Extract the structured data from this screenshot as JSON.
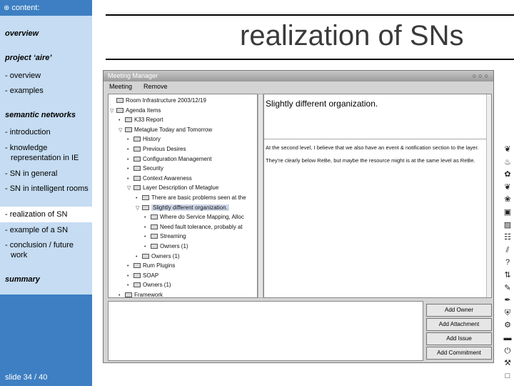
{
  "nav": {
    "header_icon": "circle-plus-icon",
    "header": "content:",
    "items": [
      {
        "label": "overview",
        "kind": "section"
      },
      {
        "label": "project ‘aire’",
        "kind": "section"
      },
      {
        "label": "- overview",
        "kind": "sub"
      },
      {
        "label": "- examples",
        "kind": "sub"
      },
      {
        "label": "semantic networks",
        "kind": "section"
      },
      {
        "label": "- introduction",
        "kind": "sub"
      },
      {
        "label": "- knowledge representation in IE",
        "kind": "sub"
      },
      {
        "label": "- SN in general",
        "kind": "sub"
      },
      {
        "label": "- SN in intelligent rooms",
        "kind": "sub"
      },
      {
        "label": "- realization of SN",
        "kind": "active"
      },
      {
        "label": "- example of a SN",
        "kind": "sub"
      },
      {
        "label": "- conclusion / future work",
        "kind": "sub"
      },
      {
        "label": "summary",
        "kind": "section"
      }
    ],
    "slide_counter": "slide 34 / 40"
  },
  "title": "realization of SNs",
  "app": {
    "window_title": "Meeting Manager",
    "menu": [
      "Meeting",
      "Remove"
    ],
    "tree": [
      {
        "label": "Room Infrastructure 2003/12/19",
        "toggle": "",
        "depth": 0
      },
      {
        "label": "Agenda Items",
        "toggle": "▽",
        "depth": 0
      },
      {
        "label": "K33 Report",
        "toggle": "•",
        "depth": 1
      },
      {
        "label": "Metaglue Today and Tomorrow",
        "toggle": "▽",
        "depth": 1
      },
      {
        "label": "History",
        "toggle": "•",
        "depth": 2
      },
      {
        "label": "Previous Desires",
        "toggle": "•",
        "depth": 2
      },
      {
        "label": "Configuration Management",
        "toggle": "•",
        "depth": 2
      },
      {
        "label": "Security",
        "toggle": "•",
        "depth": 2
      },
      {
        "label": "Context Awareness",
        "toggle": "•",
        "depth": 2
      },
      {
        "label": "Layer Description of Metaglue",
        "toggle": "▽",
        "depth": 2
      },
      {
        "label": "There are basic problems seen at the",
        "toggle": "•",
        "depth": 3
      },
      {
        "label": "Slightly different organization.",
        "toggle": "▽",
        "depth": 3,
        "selected": true
      },
      {
        "label": "Where do Service Mapping, Alloc",
        "toggle": "•",
        "depth": 4
      },
      {
        "label": "Need fault tolerance, probably at",
        "toggle": "•",
        "depth": 4
      },
      {
        "label": "Streaming",
        "toggle": "•",
        "depth": 4
      },
      {
        "label": "Owners (1)",
        "toggle": "•",
        "depth": 4
      },
      {
        "label": "Owners (1)",
        "toggle": "•",
        "depth": 3
      },
      {
        "label": "Rum Plugins",
        "toggle": "•",
        "depth": 2
      },
      {
        "label": "SOAP",
        "toggle": "•",
        "depth": 2
      },
      {
        "label": "Owners (1)",
        "toggle": "•",
        "depth": 2
      },
      {
        "label": "Framework",
        "toggle": "•",
        "depth": 1
      }
    ],
    "detail_heading": "Slightly different organization.",
    "detail_body": "At the second level, I believe that we also have an event & notification section to the layer. They're clearly below ReBe, but maybe the resource might is at the same level as ReBe.",
    "buttons": [
      "Add Owner",
      "Add Attachment",
      "Add Issue",
      "Add Commitment"
    ]
  },
  "icon_strip": [
    "leaf-icon",
    "flame-icon",
    "flower-icon",
    "leaf-icon",
    "shell-icon",
    "window-icon",
    "image-icon",
    "document-icon",
    "chart-icon",
    "question-icon",
    "arrows-icon",
    "edit-icon",
    "pen-icon",
    "shield-icon",
    "gear-icon",
    "folder-icon",
    "power-icon",
    "tool-icon",
    "display-icon"
  ],
  "colors": {
    "nav_bg": "#c5dcf2",
    "nav_accent": "#3d7fc2",
    "title_color": "#3a3a3a"
  }
}
